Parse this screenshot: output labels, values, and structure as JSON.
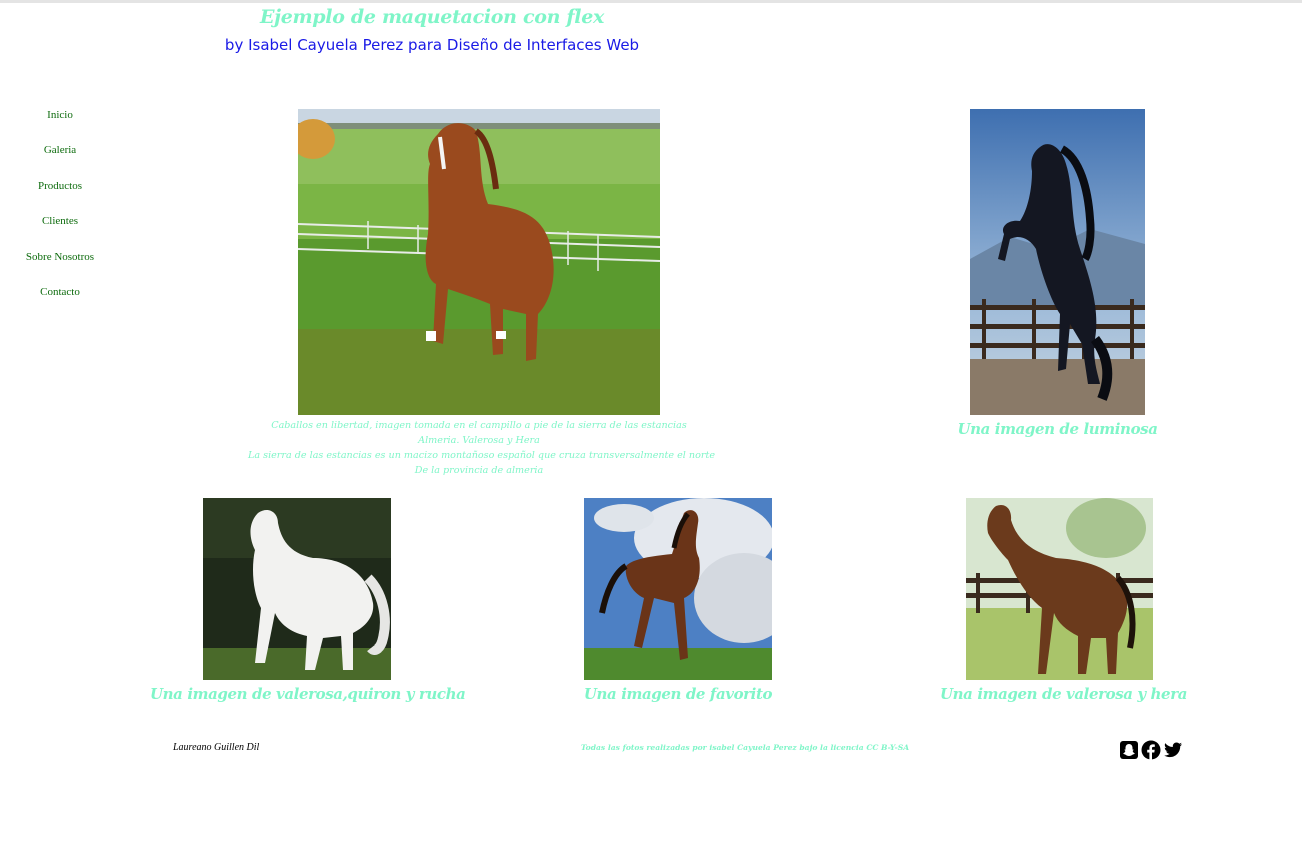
{
  "header": {
    "title": "Ejemplo de maquetacion con flex",
    "subtitle": "by Isabel Cayuela Perez para Diseño de Interfaces Web"
  },
  "nav": {
    "items": [
      "Inicio",
      "Galeria",
      "Productos",
      "Clientes",
      "Sobre Nosotros",
      "Contacto"
    ]
  },
  "gallery": {
    "main_caption_lines": [
      "Caballos en libertad, imagen tomada en el campillo a pie de la sierra de las estancias",
      "Almeria. Valerosa y Hera",
      "La sierra de las estancias es un macizo montañoso español que cruza transversalmente el norte",
      "De la provincia de almeria"
    ],
    "captions": {
      "luminosa": "Una imagen de luminosa",
      "valerosa_quiron_rucha": "Una imagen de valerosa,quiron y rucha",
      "favorito": "Una imagen de favorito",
      "valerosa_hera": "Una imagen de valerosa y hera"
    }
  },
  "footer": {
    "author": "Laureano Guillen Dil",
    "license": "Todas las fotos realizadas por isabel Cayuela Perez bajo la licencia CC B-Y-SA",
    "social_icons": [
      "snapchat-icon",
      "facebook-icon",
      "twitter-icon"
    ]
  },
  "colors": {
    "title": "#7ff5c8",
    "subtitle": "#1a1ae6",
    "nav": "#0d6b0d"
  }
}
